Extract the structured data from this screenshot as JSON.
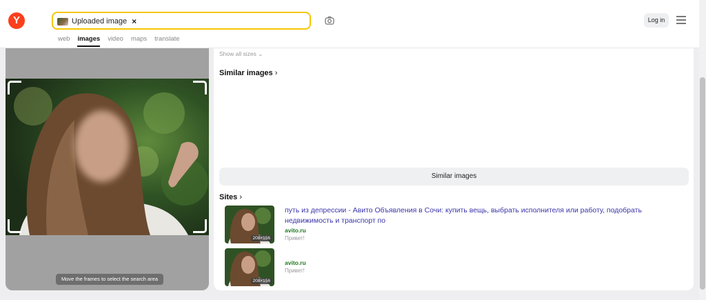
{
  "header": {
    "logo_letter": "Y",
    "search_chip_label": "Uploaded image",
    "search_chip_close": "×",
    "tabs": [
      "web",
      "images",
      "video",
      "maps",
      "translate"
    ],
    "active_tab": "images",
    "login_label": "Log in"
  },
  "preview": {
    "hint": "Move the frames to select the search area"
  },
  "results": {
    "show_all_sizes": "Show all sizes",
    "similar_heading": "Similar images",
    "similar_button": "Similar images",
    "sites_heading": "Sites",
    "sites": [
      {
        "title": "путь из депрессии - Авито Объявления в Сочи: купить вещь, выбрать исполнителя или работу, подобрать недвижимость и транспорт по",
        "domain": "avito.ru",
        "snippet": "Привет!",
        "thumb_dims": "208×156"
      },
      {
        "title": "",
        "domain": "avito.ru",
        "snippet": "Привет!",
        "thumb_dims": "208×156"
      }
    ]
  },
  "colors": {
    "brand_red": "#fc3f1d",
    "search_border": "#f7c600",
    "link": "#3b36a8",
    "domain": "#1e7a1e"
  }
}
